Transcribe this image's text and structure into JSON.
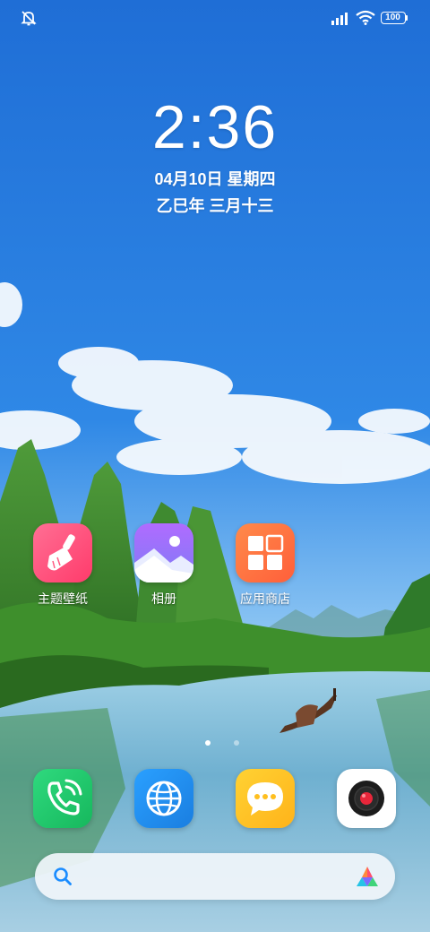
{
  "status_bar": {
    "left_icons": [
      "mute-bell-icon"
    ],
    "right_icons": [
      "signal-icon",
      "wifi-icon",
      "battery-icon"
    ],
    "battery": "100"
  },
  "lock_clock": {
    "time": "2:36",
    "date": "04月10日 星期四",
    "lunar": "乙巳年 三月十三"
  },
  "home_apps": [
    {
      "label": "主题壁纸",
      "icon": "theme-brush-icon"
    },
    {
      "label": "相册",
      "icon": "gallery-icon"
    },
    {
      "label": "应用商店",
      "icon": "app-store-icon"
    }
  ],
  "page_indicator": {
    "pages": 2,
    "current": 1
  },
  "dock": [
    {
      "name": "phone",
      "icon": "phone-icon"
    },
    {
      "name": "browser",
      "icon": "browser-globe-icon"
    },
    {
      "name": "messages",
      "icon": "messages-icon"
    },
    {
      "name": "camera",
      "icon": "camera-icon"
    }
  ],
  "search": {
    "placeholder": "",
    "left_icon": "search-icon",
    "right_icon": "assistant-logo-icon"
  },
  "colors": {
    "sky_top": "#1f6ed6",
    "theme_icon": "#ff4f7b",
    "gallery_icon": "#a56bff",
    "store_icon": "#ff6b3d",
    "phone_icon": "#21c76b",
    "browser_icon": "#1e8ff0",
    "messages_icon": "#ffc41f"
  }
}
